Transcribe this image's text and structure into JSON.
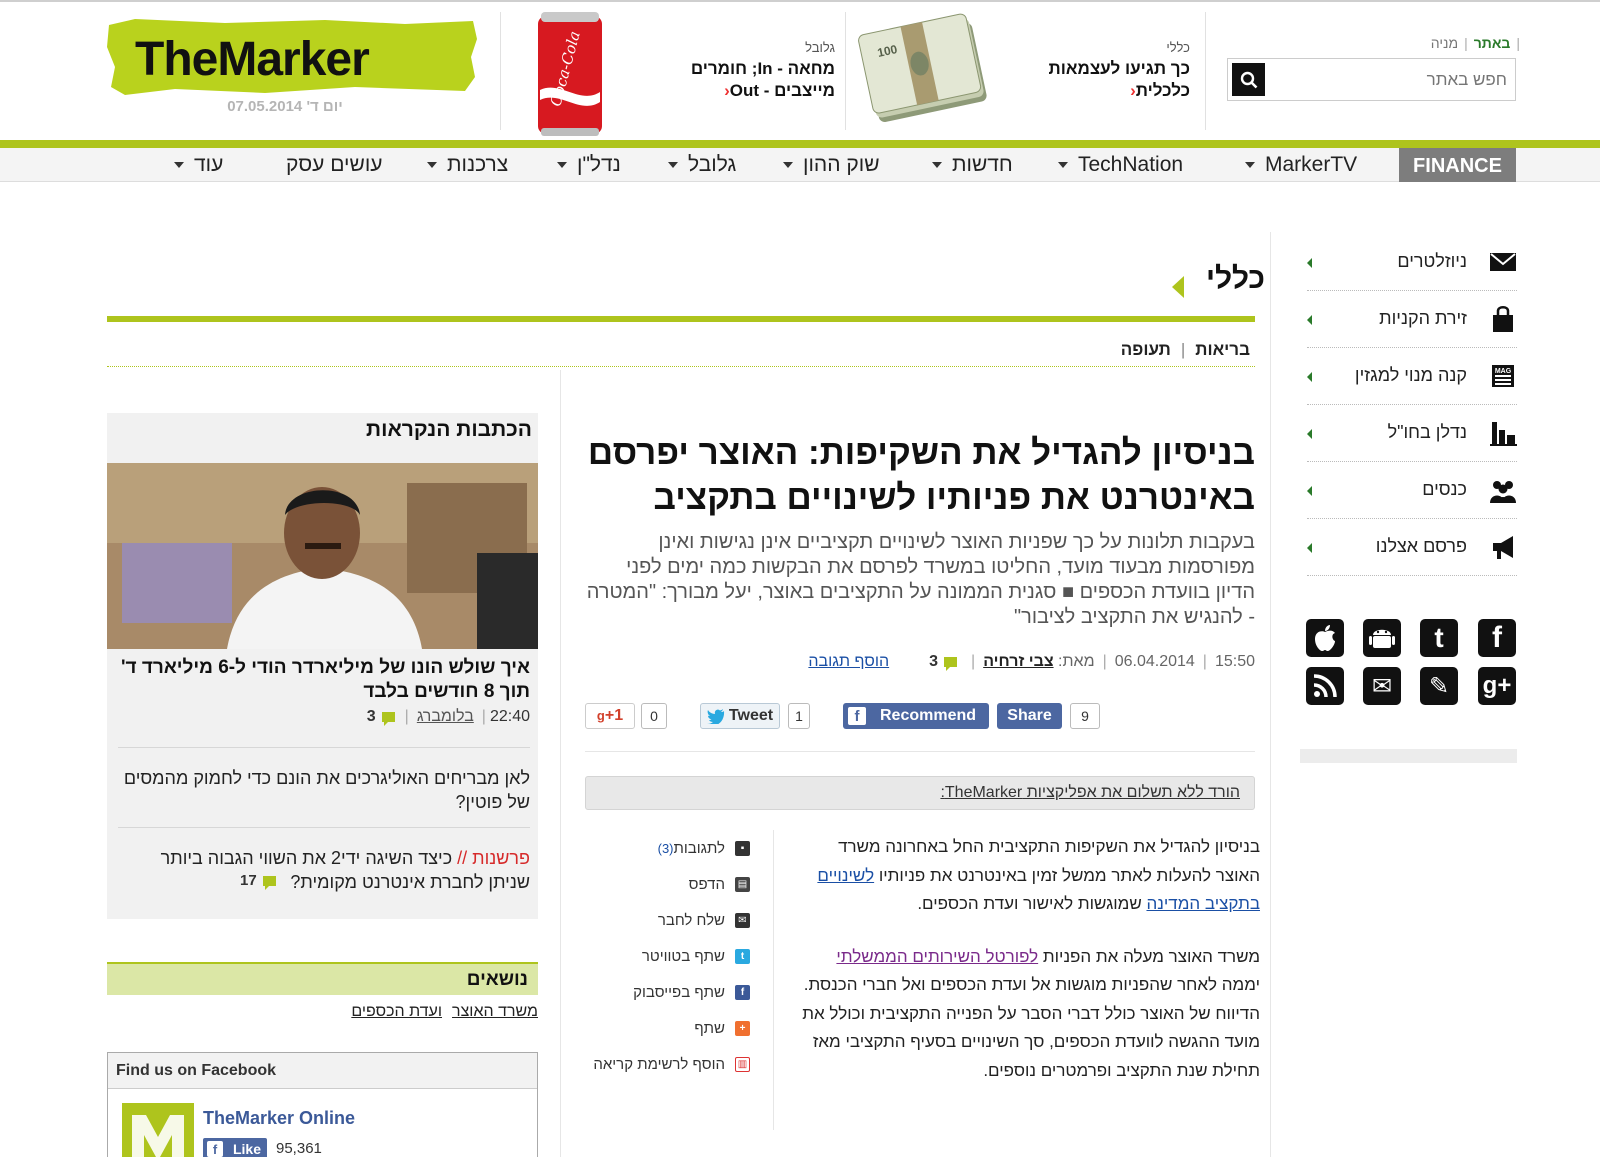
{
  "header": {
    "logo_text_the": "The",
    "logo_text_marker": "Marker",
    "date": "יום ד' 07.05.2014",
    "promo1": {
      "category": "גלובל",
      "line1": "מחאה - In; חומרים",
      "line2": "מייצבים - Out",
      "arrow": "‹"
    },
    "promo2": {
      "category": "כללי",
      "line1": "כך תגיעו לעצמאות",
      "line2": "כלכלית",
      "arrow": "‹"
    },
    "toplinks": {
      "site": "באתר",
      "stock": "מניה"
    },
    "search": {
      "placeholder": "חפש באתר"
    }
  },
  "nav": {
    "finance": "FINANCE",
    "items": [
      "MarkerTV",
      "TechNation",
      "חדשות",
      "שוק ההון",
      "גלובל",
      "נדל\"ן",
      "צרכנות",
      "עושים עסק",
      "עוד"
    ]
  },
  "section": {
    "title": "כללי",
    "subnav": [
      "בריאות",
      "תעופה"
    ]
  },
  "article": {
    "title": "בניסיון להגדיל את השקיפות: האוצר יפרסם באינטרנט את פניותיו לשינויים בתקציב",
    "lead": "בעקבות תלונות על כך שפניות האוצר לשינויים תקציביים אינן נגישות ואינן מפורסמות מבעוד מועד, החליטו במשרד לפרסם את הבקשות כמה ימים לפני הדיון בוועדת הכספים ■ סגנית הממונה על התקציבים באוצר, יעל מבורך: \"המטרה - להנגיש את התקציב לציבור\"",
    "time": "15:50",
    "date": "06.04.2014",
    "by_label": "מאת:",
    "author": "צבי זרחיה",
    "comments_count": "3",
    "add_comment": "הוסף תגובה",
    "share": {
      "fb_count": "9",
      "fb_share": "Share",
      "fb_recommend": "Recommend",
      "tw_count": "1",
      "tw_label": "Tweet",
      "gp_count": "0",
      "gp_label": "+1"
    },
    "app_bar": "הורד ללא תשלום את אפליקציות TheMarker:",
    "tools": [
      {
        "label": "לתגובות",
        "count": "(3)",
        "icon": "comment-icon"
      },
      {
        "label": "הדפס",
        "icon": "print-icon"
      },
      {
        "label": "שלח לחבר",
        "icon": "mail-icon"
      },
      {
        "label": "שתף בטוויטר",
        "icon": "twitter-icon"
      },
      {
        "label": "שתף בפייסבוק",
        "icon": "facebook-icon"
      },
      {
        "label": "שתף",
        "icon": "plus-icon"
      },
      {
        "label": "הוסף לרשימת קריאה",
        "icon": "book-icon"
      }
    ],
    "body": {
      "p1_start": "בניסיון להגדיל את השקיפות התקציבית החל באחרונה משרד האוצר להעלות לאתר ממשל זמין באינטרנט את פניותיו ",
      "p1_link": "לשינויים בתקציב המדינה",
      "p1_end": " שמוגשות לאישור ועדת הכספים.",
      "p2_start": "משרד האוצר מעלה את הפניות ",
      "p2_link": "לפורטל השירותים הממשלתי",
      "p2_end": " יממה לאחר שהפניות מוגשות אל ועדת הכספים ואל חברי הכנסת. הדיווח של האוצר כולל דברי הסבר על הפנייה התקציבית וכולל את מועד ההגשה לוועדת הכספים, סך השינויים בסעיף התקציבי מאז תחילת שנת התקציב ופרמטרים נוספים."
    }
  },
  "most_read": {
    "title": "הכתבות הנקראות",
    "item1": {
      "title": "איך שולש הונו של מיליארדר הודי ל-6 מיליארד ד' תוך 8 חודשים בלבד",
      "time": "22:40",
      "source": "בלומברג",
      "comments": "3"
    },
    "item2": {
      "title": "לאן מבריחים האוליגרכים את הונם כדי לחמוק מהמסים של פוטין?"
    },
    "item3": {
      "tag": "פרשנות //",
      "title": " כיצד השיגה ידי2 את השווי הגבוה ביותר שניתן לחברת אינטרנט מקומית?",
      "comments": "17"
    }
  },
  "topics": {
    "title": "נושאים",
    "items": [
      "משרד האוצר",
      "ועדת הכספים"
    ]
  },
  "facebook": {
    "header": "Find us on Facebook",
    "page_name": "TheMarker Online",
    "like": "Like",
    "count": "95,361"
  },
  "right_sidebar": {
    "items": [
      {
        "label": "ניוזלטרים",
        "icon": "envelope-icon"
      },
      {
        "label": "זירת הקניות",
        "icon": "shopping-bag-icon"
      },
      {
        "label": "קנה מנוי למגזין",
        "icon": "magazine-icon"
      },
      {
        "label": "נדלן בחו\"ל",
        "icon": "buildings-icon"
      },
      {
        "label": "כנסים",
        "icon": "people-icon"
      },
      {
        "label": "פרסם אצלנו",
        "icon": "megaphone-icon"
      }
    ],
    "social": [
      "facebook-icon",
      "twitter-icon",
      "android-icon",
      "apple-icon",
      "googleplus-icon",
      "pencil-icon",
      "mail-icon",
      "rss-icon"
    ]
  },
  "colors": {
    "brand_green": "#aec41d",
    "link_blue": "#1a4fa5",
    "fb_blue": "#4c67a1",
    "nav_gray": "#7d7d7d"
  }
}
